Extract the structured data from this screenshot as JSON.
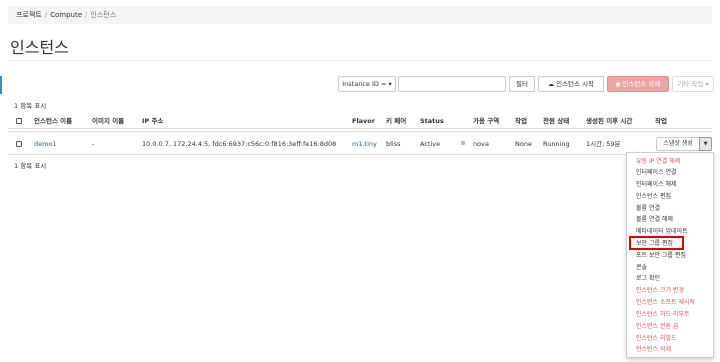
{
  "breadcrumb": {
    "items": [
      "프로젝트",
      "Compute",
      "인스턴스"
    ],
    "sep": "/"
  },
  "page": {
    "title": "인스턴스"
  },
  "toolbar": {
    "filter_select": "Instance ID = ▾",
    "filter_button": "필터",
    "launch_button": "인스턴스 시작",
    "delete_button": "인스턴스 삭제",
    "more_actions": "기타 작업 ▾"
  },
  "table": {
    "count_top": "1 항목 표시",
    "count_bottom": "1 항목 표시",
    "headers": [
      "인스턴스 이름",
      "이미지 이름",
      "IP 주소",
      "Flavor",
      "키 페어",
      "Status",
      "가용 구역",
      "작업",
      "전원 상태",
      "생성된 이후 시간",
      "작업"
    ],
    "row": {
      "name": "demo1",
      "image": "-",
      "ip": "10.0.0.7, 172.24.4.5, fdc6:6937:c56c:0:f816:3eff:fe16:8d08",
      "flavor": "m1.tiny",
      "key_pair": "bliss",
      "status": "Active",
      "zone": "nova",
      "task": "None",
      "power": "Running",
      "age": "1시간, 59분",
      "action_button": "스냅샷 생성"
    }
  },
  "menu": {
    "items": [
      {
        "label": "유동 IP 연결 해제",
        "danger": true
      },
      {
        "label": "인터페이스 연결",
        "danger": false
      },
      {
        "label": "인터페이스 해제",
        "danger": false
      },
      {
        "label": "인스턴스 편집",
        "danger": false
      },
      {
        "label": "볼륨 연결",
        "danger": false
      },
      {
        "label": "볼륨 연결 해제",
        "danger": false
      },
      {
        "label": "메타데이터 업데이트",
        "danger": false
      },
      {
        "label": "보안 그룹 편집",
        "danger": false,
        "highlighted": true
      },
      {
        "label": "포트 보안 그룹 편집",
        "danger": false
      },
      {
        "label": "콘솔",
        "danger": false
      },
      {
        "label": "로그 확인",
        "danger": false
      },
      {
        "label": "인스턴스 크기 변경",
        "danger": true
      },
      {
        "label": "인스턴스 소프트 재시작",
        "danger": true
      },
      {
        "label": "인스턴스 하드 리부트",
        "danger": true
      },
      {
        "label": "인스턴스 전원 끔",
        "danger": true
      },
      {
        "label": "인스턴스 리빌드",
        "danger": true
      },
      {
        "label": "인스턴스 삭제",
        "danger": true
      }
    ]
  },
  "colors": {
    "link": "#2a6496",
    "danger": "#d9534f",
    "highlight": "#e00000",
    "accent": "#428bca"
  }
}
